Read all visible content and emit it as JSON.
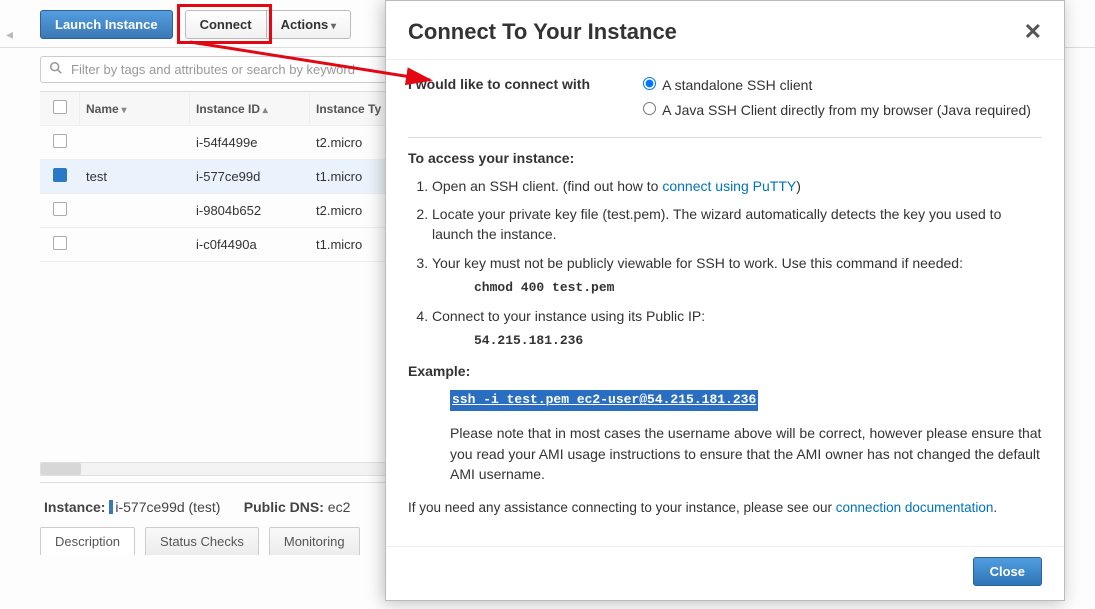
{
  "toolbar": {
    "launch": "Launch Instance",
    "connect": "Connect",
    "actions": "Actions"
  },
  "search": {
    "placeholder": "Filter by tags and attributes or search by keyword"
  },
  "columns": {
    "name": "Name",
    "id": "Instance ID",
    "type": "Instance Ty"
  },
  "rows": [
    {
      "sel": false,
      "name": "",
      "id": "i-54f4499e",
      "type": "t2.micro"
    },
    {
      "sel": true,
      "name": "test",
      "id": "i-577ce99d",
      "type": "t1.micro"
    },
    {
      "sel": false,
      "name": "",
      "id": "i-9804b652",
      "type": "t2.micro"
    },
    {
      "sel": false,
      "name": "",
      "id": "i-c0f4490a",
      "type": "t1.micro"
    }
  ],
  "details": {
    "label": "Instance:",
    "id": "i-577ce99d (test)",
    "dns_label": "Public DNS:",
    "dns": "ec2"
  },
  "tabs": {
    "desc": "Description",
    "status": "Status Checks",
    "monitor": "Monitoring"
  },
  "modal": {
    "title": "Connect To Your Instance",
    "opt_label": "I would like to connect with",
    "opt1": "A standalone SSH client",
    "opt2": "A Java SSH Client directly from my browser (Java required)",
    "access_head": "To access your instance:",
    "step1a": "Open an SSH client. (find out how to ",
    "step1_link": "connect using PuTTY",
    "step1b": ")",
    "step2": "Locate your private key file (test.pem). The wizard automatically detects the key you used to launch the instance.",
    "step3": "Your key must not be publicly viewable for SSH to work. Use this command if needed:",
    "cmd_chmod": "chmod 400 test.pem",
    "step4": "Connect to your instance using its Public IP:",
    "ip": "54.215.181.236",
    "example_head": "Example:",
    "example_cmd": "ssh -i test.pem ec2-user@54.215.181.236",
    "note": "Please note that in most cases the username above will be correct, however please ensure that you read your AMI usage instructions to ensure that the AMI owner has not changed the default AMI username.",
    "assist_a": "If you need any assistance connecting to your instance, please see our ",
    "assist_link": "connection documentation",
    "assist_b": ".",
    "close": "Close"
  }
}
